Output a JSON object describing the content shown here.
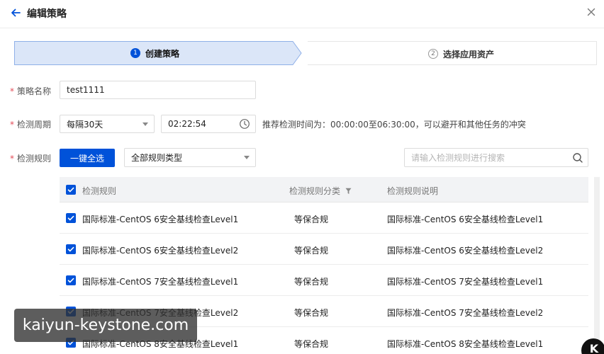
{
  "header": {
    "title": "编辑策略",
    "back_icon": "arrow-left-icon",
    "close_icon": "close-icon"
  },
  "steps": [
    {
      "number": "1",
      "label": "创建策略",
      "state": "active"
    },
    {
      "number": "2",
      "label": "选择应用资产",
      "state": "inactive"
    }
  ],
  "form": {
    "name": {
      "label": "策略名称",
      "value": "test1111"
    },
    "period": {
      "label": "检测周期",
      "interval": "每隔30天",
      "time": "02:22:54",
      "hint": "推荐检测时间为：00:00:00至06:30:00，可以避开和其他任务的冲突"
    },
    "rules": {
      "label": "检测规则",
      "select_all_label": "一键全选",
      "type_filter": "全部规则类型",
      "search_placeholder": "请输入检测规则进行搜索"
    }
  },
  "table": {
    "columns": [
      "检测规则",
      "检测规则分类",
      "检测规则说明"
    ],
    "rows": [
      {
        "rule": "国际标准-CentOS 6安全基线检查Level1",
        "category": "等保合规",
        "description": "国际标准-CentOS 6安全基线检查Level1",
        "checked": true
      },
      {
        "rule": "国际标准-CentOS 6安全基线检查Level2",
        "category": "等保合规",
        "description": "国际标准-CentOS 6安全基线检查Level2",
        "checked": true
      },
      {
        "rule": "国际标准-CentOS 7安全基线检查Level1",
        "category": "等保合规",
        "description": "国际标准-CentOS 7安全基线检查Level1",
        "checked": true
      },
      {
        "rule": "国际标准-CentOS 7安全基线检查Level2",
        "category": "等保合规",
        "description": "国际标准-CentOS 7安全基线检查Level2",
        "checked": true
      },
      {
        "rule": "国际标准-CentOS 8安全基线检查Level1",
        "category": "等保合规",
        "description": "国际标准-CentOS 8安全基线检查Level1",
        "checked": true
      }
    ]
  },
  "watermark": {
    "text": "kaiyun-keystone.com",
    "corner_logo": "K"
  },
  "colors": {
    "primary": "#0052d9",
    "required": "#e34d59",
    "step_active_bg": "#dbe6f8"
  }
}
